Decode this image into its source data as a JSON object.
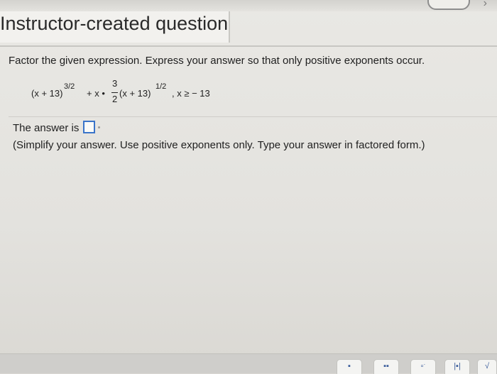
{
  "header": {
    "title": "Instructor-created question"
  },
  "question": {
    "instruction": "Factor the given expression. Express your answer so that only positive exponents occur.",
    "expression": {
      "open1": "(x + 13)",
      "exp1": "3/2",
      "plus": "+ x •",
      "num": "3",
      "den": "2",
      "open2": "(x + 13)",
      "exp2": "1/2",
      "condition": ", x ≥ − 13"
    }
  },
  "answer": {
    "label": "The answer is",
    "value": ""
  },
  "hint": "(Simplify your answer. Use positive exponents only. Type your answer in factored form.)",
  "toolbar": {
    "icons": [
      "fraction-icon",
      "mixed-number-icon",
      "exponent-icon",
      "absolute-value-icon",
      "square-root-icon"
    ],
    "glyphs": [
      "▪",
      "▪▪",
      "▫ˑ",
      "|▪|",
      "√"
    ]
  }
}
